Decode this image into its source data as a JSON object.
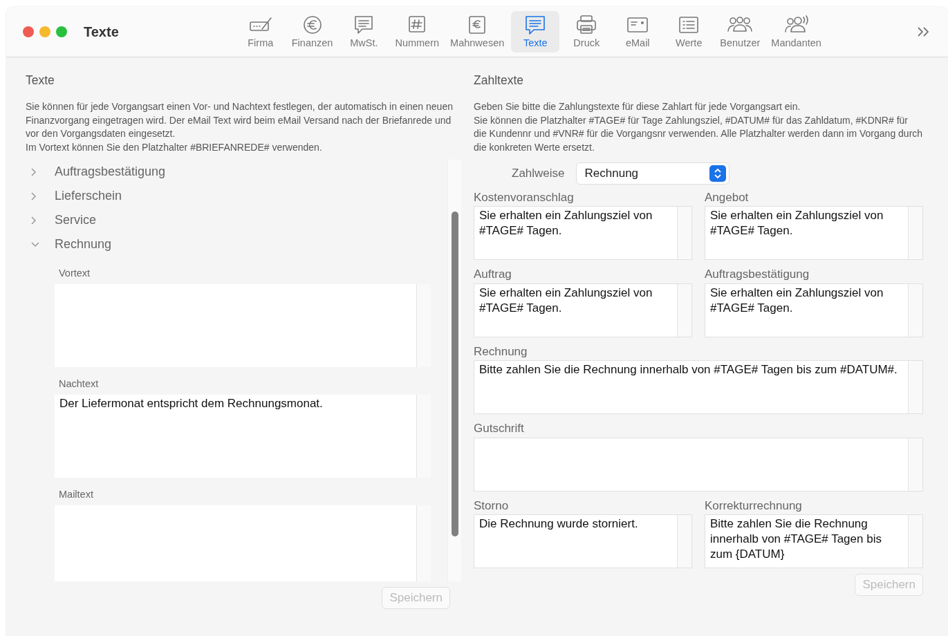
{
  "window": {
    "title": "Texte"
  },
  "toolbar": [
    {
      "label": "Firma",
      "selected": false
    },
    {
      "label": "Finanzen",
      "selected": false
    },
    {
      "label": "MwSt.",
      "selected": false
    },
    {
      "label": "Nummern",
      "selected": false
    },
    {
      "label": "Mahnwesen",
      "selected": false
    },
    {
      "label": "Texte",
      "selected": true
    },
    {
      "label": "Druck",
      "selected": false
    },
    {
      "label": "eMail",
      "selected": false
    },
    {
      "label": "Werte",
      "selected": false
    },
    {
      "label": "Benutzer",
      "selected": false
    },
    {
      "label": "Mandanten",
      "selected": false
    }
  ],
  "left": {
    "title": "Texte",
    "description": "Sie können für jede Vorgangsart einen Vor- und Nachtext festlegen, der automatisch in einen neuen Finanzvorgang eingetragen wird. Der eMail Text wird beim eMail Versand nach der Briefanrede und vor den Vorgangsdaten eingesetzt.\nIm Vortext können Sie den Platzhalter #BRIEFANREDE# verwenden.",
    "tree": [
      {
        "label": "Auftragsbestätigung",
        "expanded": false
      },
      {
        "label": "Lieferschein",
        "expanded": false
      },
      {
        "label": "Service",
        "expanded": false
      },
      {
        "label": "Rechnung",
        "expanded": true,
        "fields": [
          {
            "label": "Vortext"
          },
          {
            "label": "Nachtext",
            "value": "Der Liefermonat entspricht dem Rechnungsmonat."
          },
          {
            "label": "Mailtext"
          }
        ]
      }
    ],
    "save": {
      "label": "Speichern",
      "disabled": true
    }
  },
  "right": {
    "title": "Zahltexte",
    "description": "Geben Sie bitte die Zahlungstexte für diese Zahlart für jede Vorgangsart ein.\nSie können die Platzhalter #TAGE# für Tage Zahlungsziel, #DATUM# für das Zahldatum, #KDNR# für die Kundennr und #VNR# für die Vorgangsnr verwenden. Alle Platzhalter werden dann im Vorgang durch die konkreten Werte ersetzt.",
    "payment": {
      "label": "Zahlweise",
      "value": "Rechnung"
    },
    "fields": [
      {
        "label": "Kostenvoranschlag",
        "kind": "half",
        "value": "Sie erhalten ein Zahlungsziel von #TAGE# Tagen."
      },
      {
        "label": "Angebot",
        "kind": "half",
        "value": "Sie erhalten ein Zahlungsziel von #TAGE# Tagen."
      },
      {
        "label": "Auftrag",
        "kind": "half",
        "value": "Sie erhalten ein Zahlungsziel von #TAGE# Tagen."
      },
      {
        "label": "Auftragsbestätigung",
        "kind": "half",
        "value": "Sie erhalten ein Zahlungsziel von #TAGE# Tagen."
      },
      {
        "label": "Rechnung",
        "kind": "wide",
        "value": "Bitte zahlen Sie die Rechnung innerhalb von #TAGE# Tagen bis zum #DATUM#."
      },
      {
        "label": "Gutschrift",
        "kind": "wide"
      },
      {
        "label": "Storno",
        "kind": "half",
        "value": "Die Rechnung wurde storniert."
      },
      {
        "label": "Korrekturrechnung",
        "kind": "half",
        "value": "Bitte zahlen Sie die Rechnung innerhalb von #TAGE# Tagen bis zum {DATUM}"
      }
    ],
    "save": {
      "label": "Speichern",
      "disabled": true
    }
  }
}
